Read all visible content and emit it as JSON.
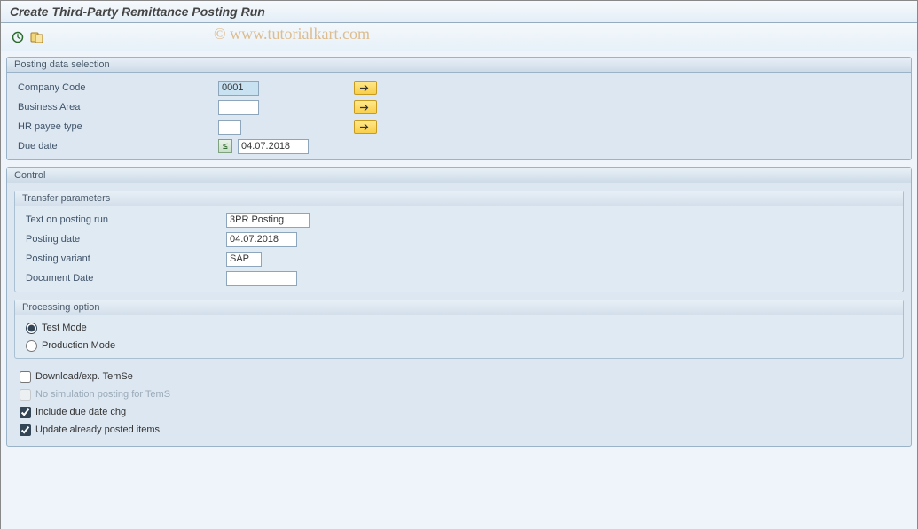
{
  "title": "Create Third-Party Remittance Posting Run",
  "watermark": "© www.tutorialkart.com",
  "groups": {
    "posting_data": {
      "title": "Posting data selection",
      "company_code": {
        "label": "Company Code",
        "value": "0001"
      },
      "business_area": {
        "label": "Business Area",
        "value": ""
      },
      "hr_payee_type": {
        "label": "HR payee type",
        "value": ""
      },
      "due_date": {
        "label": "Due date",
        "operator": "≤",
        "value": "04.07.2018"
      }
    },
    "control": {
      "title": "Control",
      "transfer": {
        "title": "Transfer parameters",
        "text_on_posting_run": {
          "label": "Text on posting run",
          "value": "3PR Posting"
        },
        "posting_date": {
          "label": "Posting date",
          "value": "04.07.2018"
        },
        "posting_variant": {
          "label": "Posting variant",
          "value": "SAP"
        },
        "document_date": {
          "label": "Document Date",
          "value": ""
        }
      },
      "processing": {
        "title": "Processing option",
        "test_mode": "Test Mode",
        "production_mode": "Production Mode",
        "selected": "test"
      },
      "checks": {
        "download_temse": {
          "label": "Download/exp. TemSe",
          "checked": false,
          "disabled": false
        },
        "no_sim_posting": {
          "label": "No simulation posting for TemS",
          "checked": false,
          "disabled": true
        },
        "include_due_date": {
          "label": "Include due date chg",
          "checked": true,
          "disabled": false
        },
        "update_posted": {
          "label": "Update already posted items",
          "checked": true,
          "disabled": false
        }
      }
    }
  }
}
